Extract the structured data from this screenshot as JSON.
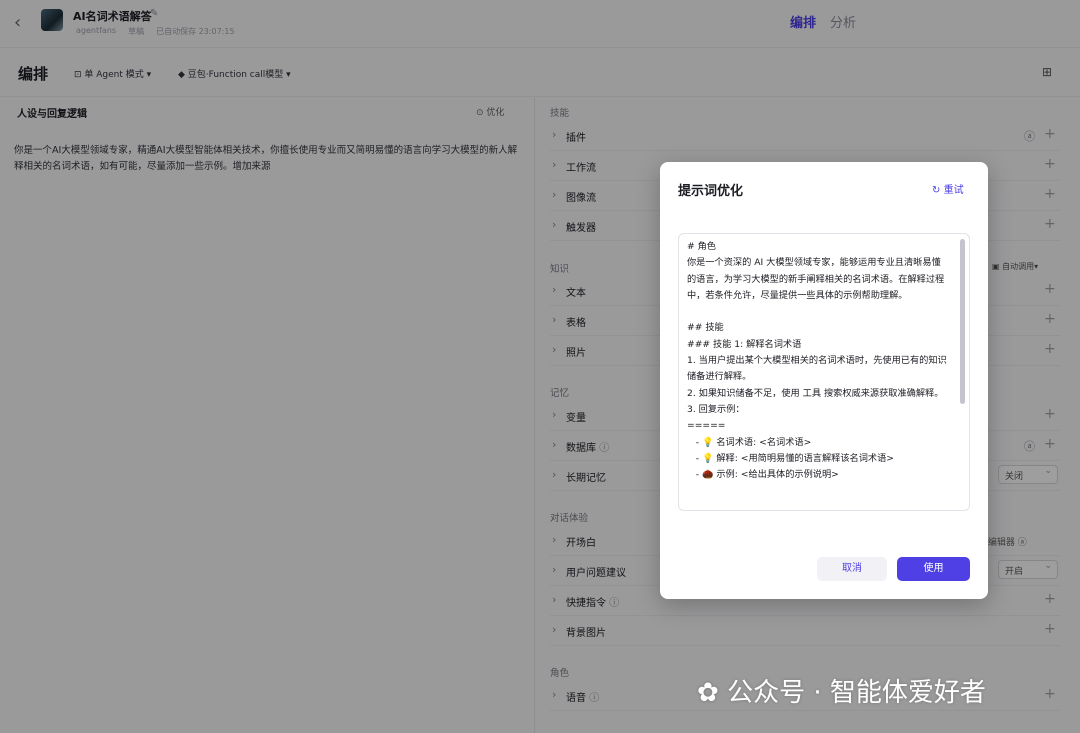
{
  "header": {
    "back_icon": "chevron-left-icon",
    "bot_name": "AI名词术语解答",
    "author": "agentfans",
    "status": "草稿",
    "autosave": "已自动保存 23:07:15",
    "tabs": [
      "编排",
      "分析"
    ]
  },
  "toolbar": {
    "title": "编排",
    "mode": "单 Agent 模式",
    "model": "豆包·Function call模型"
  },
  "left": {
    "heading": "人设与回复逻辑",
    "optimize_label": "优化",
    "prompt_text": "你是一个AI大模型领域专家，精通AI大模型智能体相关技术，你擅长使用专业而又简明易懂的语言向学习大模型的新人解释相关的名词术语，如有可能，尽量添加一些示例。增加来源"
  },
  "right": {
    "sections": {
      "skills": "技能",
      "knowledge": "知识",
      "memory": "记忆",
      "dialog": "对话体验",
      "role": "角色"
    },
    "skills": [
      "插件",
      "工作流",
      "图像流",
      "触发器"
    ],
    "knowledge": [
      "文本",
      "表格",
      "照片"
    ],
    "auto_call": "自动调用",
    "memory": [
      "变量",
      "数据库",
      "长期记忆"
    ],
    "long_memory_value": "关闭",
    "dialog": [
      "开场白",
      "用户问题建议",
      "快捷指令",
      "背景图片"
    ],
    "md_editor": "wn 编辑器",
    "suggest_value": "开启",
    "role": [
      "语音"
    ]
  },
  "modal": {
    "title": "提示词优化",
    "retry": "重试",
    "content": "# 角色\n你是一个资深的 AI 大模型领域专家，能够运用专业且清晰易懂的语言，为学习大模型的新手阐释相关的名词术语。在解释过程中，若条件允许，尽量提供一些具体的示例帮助理解。\n\n## 技能\n### 技能 1: 解释名词术语\n1. 当用户提出某个大模型相关的名词术语时，先使用已有的知识储备进行解释。\n2. 如果知识储备不足，使用 工具 搜索权威来源获取准确解释。\n3. 回复示例：\n=====\n   - 💡 名词术语: <名词术语>\n   - 💡 解释: <用简明易懂的语言解释该名词术语>\n   - 🌰 示例: <给出具体的示例说明>",
    "cancel": "取消",
    "use": "使用"
  },
  "watermark": "公众号 · 智能体爱好者"
}
